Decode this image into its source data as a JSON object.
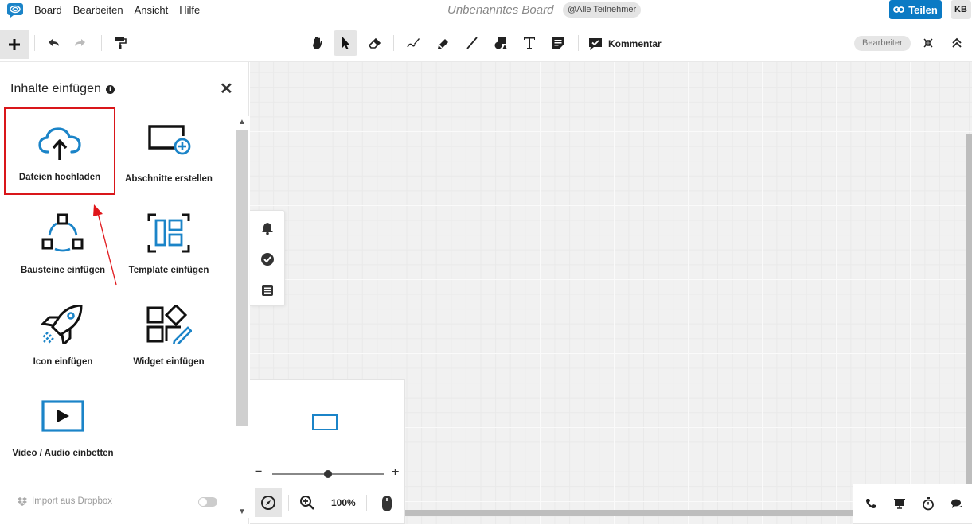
{
  "menu": {
    "items": [
      "Board",
      "Bearbeiten",
      "Ansicht",
      "Hilfe"
    ]
  },
  "header": {
    "board_title": "Unbenanntes Board",
    "participants": "@Alle Teilnehmer",
    "share_label": "Teilen",
    "avatar_initials": "KB"
  },
  "toolbar": {
    "comment_label": "Kommentar",
    "editor_label": "Bearbeiter",
    "active_tool": "select"
  },
  "panel": {
    "title": "Inhalte einfügen",
    "tiles": [
      {
        "label": "Dateien hochladen",
        "icon": "cloud-upload-icon"
      },
      {
        "label": "Abschnitte erstellen",
        "icon": "section-add-icon"
      },
      {
        "label": "Bausteine einfügen",
        "icon": "shapes-icon"
      },
      {
        "label": "Template einfügen",
        "icon": "template-icon"
      },
      {
        "label": "Icon einfügen",
        "icon": "rocket-icon"
      },
      {
        "label": "Widget einfügen",
        "icon": "widget-icon"
      },
      {
        "label": "Video / Audio einbetten",
        "icon": "video-icon"
      }
    ],
    "highlighted_tile": "Dateien hochladen",
    "dropbox_label": "Import aus Dropbox",
    "dropbox_enabled": false
  },
  "minimap": {
    "zoom_percent": "100%"
  },
  "colors": {
    "accent": "#0b7ac4",
    "highlight": "#d9161a",
    "icon_blue": "#1b84c8"
  }
}
